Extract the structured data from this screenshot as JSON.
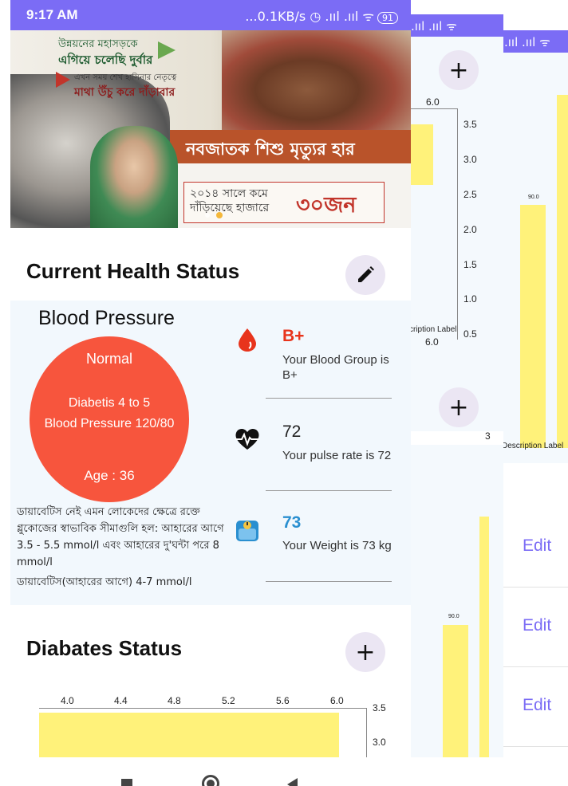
{
  "status_bar": {
    "time": "9:17 AM",
    "icons": "...0.1KB/s ◷ .ııl .ııl ᯤ",
    "battery": "91",
    "partial_icons": ".ııl .ııl ᯤ"
  },
  "banner": {
    "line1": "উন্নয়নের মহাসড়কে",
    "line2": "এগিয়ে চলেছি দুর্বার",
    "line3": "এখন সময় শেখ হাসিনার নেতৃত্বে",
    "line4": "মাথা উঁচু করে দাঁড়াবার",
    "headline": "নবজাতক শিশু মৃত্যুর হার",
    "box_text": "২০১৪ সালে কমে দাঁড়িয়েছে হাজারে",
    "box_number": "৩০জন"
  },
  "current_health": {
    "title": "Current Health Status",
    "edit_icon": "pencil-icon"
  },
  "blood_pressure": {
    "title": "Blood Pressure",
    "status": "Normal",
    "diabetis": "Diabetis 4 to 5",
    "bp": "Blood Pressure 120/80",
    "age": "Age : 36",
    "info_text": "ডায়াবেটিস নেই এমন লোকেদের ক্ষেত্রে রক্তে গ্লুকোজের স্বাভাবিক সীমাগুলি হল: আহারের আগে 3.5 - 5.5 mmol/l এবং আহারের দু'ঘন্টা পরে 8 mmol/l",
    "info_text2": "ডায়াবেটিস(আহারের আগে) 4-7 mmol/l"
  },
  "stats": [
    {
      "icon": "blood-drop-icon",
      "value": "B+",
      "desc": "Your Blood Group is B+",
      "color": "#e8341c"
    },
    {
      "icon": "heartbeat-icon",
      "value": "72",
      "desc": "Your pulse rate is 72",
      "color": "#222222"
    },
    {
      "icon": "scale-icon",
      "value": "73",
      "desc": "Your Weight is 73 kg",
      "color": "#2a8fd0"
    }
  ],
  "diabetes": {
    "title": "Diabates Status",
    "add_icon": "plus-icon"
  },
  "chart_data": [
    {
      "type": "bar",
      "orientation": "horizontal",
      "x_ticks": [
        "4.0",
        "4.4",
        "4.8",
        "5.2",
        "5.6",
        "6.0"
      ],
      "y_ticks": [
        "3.5",
        "3.0"
      ],
      "values": [
        6.0
      ]
    },
    {
      "type": "bar",
      "x_ticks": [
        "6.0"
      ],
      "y_ticks": [
        "3.5",
        "3.0",
        "2.5",
        "2.0",
        "1.5",
        "1.0",
        "0.5"
      ],
      "bottom_label": "6.0",
      "description_label": "cription Label"
    },
    {
      "type": "bar",
      "value_labels": [
        "90.0"
      ],
      "description_label": "Description Label"
    },
    {
      "type": "bar",
      "value_labels": [
        "90.0"
      ],
      "top_value": "3"
    }
  ],
  "edit_rows": [
    "Edit",
    "Edit",
    "Edit"
  ],
  "fab_plus": "+",
  "nav": {
    "recent": "recent-apps-button",
    "home": "home-button",
    "back": "back-button"
  }
}
